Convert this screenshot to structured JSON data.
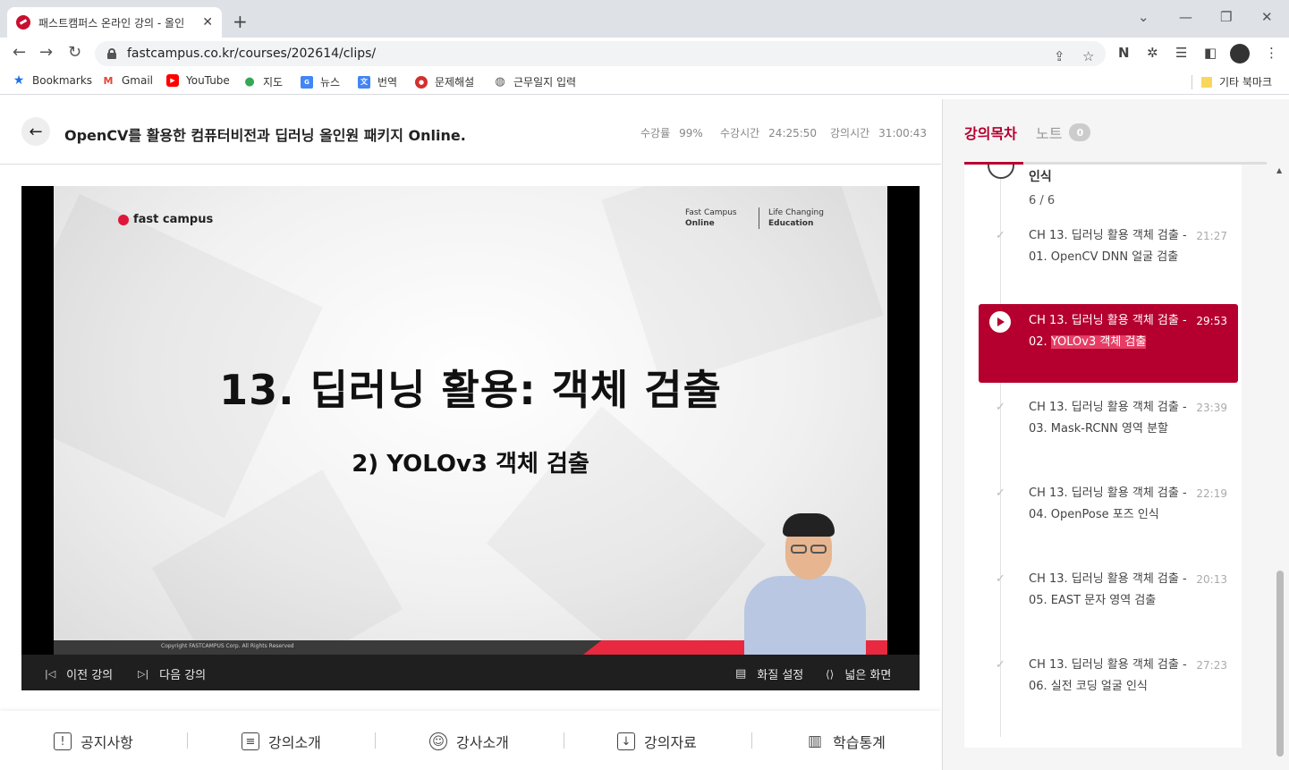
{
  "browser": {
    "tab_title": "패스트캠퍼스 온라인 강의 - 올인",
    "tab_close": "✕",
    "new_tab": "+",
    "url": "fastcampus.co.kr/courses/202614/clips/",
    "bookmarks": [
      {
        "label": "Bookmarks",
        "icon": "star-icon"
      },
      {
        "label": "Gmail",
        "icon": "gmail-icon"
      },
      {
        "label": "YouTube",
        "icon": "youtube-icon"
      },
      {
        "label": "지도",
        "icon": "maps-icon"
      },
      {
        "label": "뉴스",
        "icon": "news-icon"
      },
      {
        "label": "번역",
        "icon": "translate-icon"
      },
      {
        "label": "문제해설",
        "icon": "folder-icon"
      },
      {
        "label": "근무일지 입력",
        "icon": "globe-icon"
      }
    ],
    "other_bookmarks": "기타 북마크"
  },
  "header": {
    "course_title": "OpenCV를 활용한 컴퓨터비전과 딥러닝 올인원 패키지 Online.",
    "stats": [
      {
        "label": "수강률",
        "value": "99%"
      },
      {
        "label": "수강시간",
        "value": "24:25:50"
      },
      {
        "label": "강의시간",
        "value": "31:00:43"
      }
    ]
  },
  "slide": {
    "brand": "fast campus",
    "tag1_top": "Fast Campus",
    "tag1_bottom": "Online",
    "tag2_top": "Life Changing",
    "tag2_bottom": "Education",
    "heading": "13. 딥러닝 활용: 객체 검출",
    "subheading": "2) YOLOv3 객체 검출",
    "copyright": "Copyright FASTCAMPUS Corp. All Rights Reserved"
  },
  "controls": {
    "prev": "이전 강의",
    "next": "다음 강의",
    "quality": "화질 설정",
    "wide": "넓은 화면"
  },
  "bottom_tabs": [
    {
      "label": "공지사항",
      "icon": "notice-icon",
      "glyph": "!"
    },
    {
      "label": "강의소개",
      "icon": "clipboard-icon",
      "glyph": "≡"
    },
    {
      "label": "강사소개",
      "icon": "person-icon",
      "glyph": "☺"
    },
    {
      "label": "강의자료",
      "icon": "download-icon",
      "glyph": "↓"
    },
    {
      "label": "학습통계",
      "icon": "stats-icon",
      "glyph": "▥"
    }
  ],
  "panel": {
    "tab_list": "강의목차",
    "tab_note": "노트",
    "note_count": "0",
    "section_title_tail": "인식",
    "section_progress": "6 / 6",
    "items": [
      {
        "title": "CH 13. 딥러닝 활용 객체 검출 - 01. OpenCV DNN 얼굴 검출",
        "duration": "21:27"
      },
      {
        "title": "CH 13. 딥러닝 활용 객체 검출 - 03. Mask-RCNN 영역 분할",
        "duration": "23:39"
      },
      {
        "title": "CH 13. 딥러닝 활용 객체 검출 - 04. OpenPose 포즈 인식",
        "duration": "22:19"
      },
      {
        "title": "CH 13. 딥러닝 활용 객체 검출 - 05. EAST 문자 영역 검출",
        "duration": "20:13"
      },
      {
        "title": "CH 13. 딥러닝 활용 객체 검출 - 06. 실전 코딩 얼굴 인식",
        "duration": "27:23"
      }
    ],
    "active": {
      "title_plain": "CH 13. 딥러닝 활용 객체 검출 - 02. ",
      "title_highlight": "YOLOv3 객체 검출",
      "duration": "29:53"
    }
  },
  "colors": {
    "accent": "#b5002f",
    "highlight": "#e63d64",
    "slide_red": "#e8293f"
  }
}
